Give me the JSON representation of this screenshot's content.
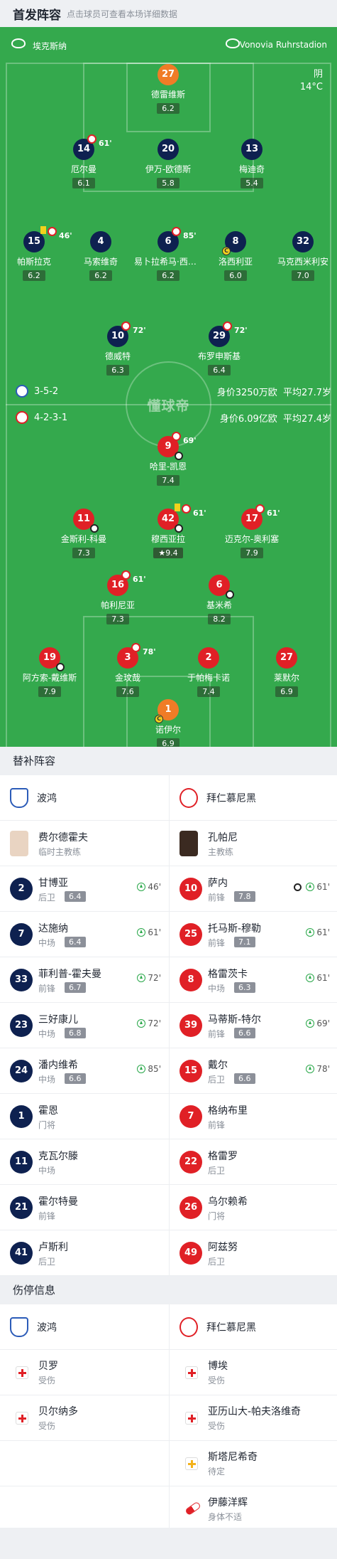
{
  "header": {
    "title": "首发阵容",
    "subtitle": "点击球员可查看本场详细数据"
  },
  "pitch": {
    "home_team": "埃克斯纳",
    "away_venue": "Vonovia Ruhrstadion",
    "weather": "阴",
    "temperature": "14°C",
    "watermark": "懂球帝",
    "home_formation": "3-5-2",
    "home_value": "身价3250万欧",
    "home_age": "平均27.7岁",
    "away_formation": "4-2-3-1",
    "away_value": "身价6.09亿欧",
    "away_age": "平均27.4岁"
  },
  "home_players": [
    {
      "num": "27",
      "name": "德雷维斯",
      "rating": "6.2"
    },
    {
      "num": "14",
      "name": "厄尔曼",
      "rating": "6.1",
      "sub": "61'"
    },
    {
      "num": "20",
      "name": "伊万-欧德斯",
      "rating": "5.8"
    },
    {
      "num": "13",
      "name": "梅迪奇",
      "rating": "5.4"
    },
    {
      "num": "15",
      "name": "帕斯拉克",
      "rating": "6.2",
      "sub": "46'"
    },
    {
      "num": "4",
      "name": "马索维奇",
      "rating": "6.2"
    },
    {
      "num": "6",
      "name": "易卜拉希马·西索科",
      "rating": "6.2",
      "sub": "85'"
    },
    {
      "num": "8",
      "name": "洛西利亚",
      "rating": "6.0"
    },
    {
      "num": "32",
      "name": "马克西米利安",
      "rating": "7.0"
    },
    {
      "num": "10",
      "name": "德威特",
      "rating": "6.3",
      "sub": "72'"
    },
    {
      "num": "29",
      "name": "布罗申斯基",
      "rating": "6.4",
      "sub": "72'"
    }
  ],
  "away_players": [
    {
      "num": "9",
      "name": "哈里-凯恩",
      "rating": "7.4",
      "sub": "69'"
    },
    {
      "num": "11",
      "name": "金斯利-科曼",
      "rating": "7.3"
    },
    {
      "num": "42",
      "name": "穆西亚拉",
      "rating": "9.4",
      "sub": "61'"
    },
    {
      "num": "17",
      "name": "迈克尔-奥利塞",
      "rating": "7.9",
      "sub": "61'"
    },
    {
      "num": "16",
      "name": "帕利尼亚",
      "rating": "7.3",
      "sub": "61'"
    },
    {
      "num": "6",
      "name": "基米希",
      "rating": "8.2"
    },
    {
      "num": "19",
      "name": "阿方索-戴维斯",
      "rating": "7.9"
    },
    {
      "num": "3",
      "name": "金玟哉",
      "rating": "7.6",
      "sub": "78'"
    },
    {
      "num": "2",
      "name": "于帕梅卡诺",
      "rating": "7.4"
    },
    {
      "num": "27",
      "name": "莱默尔",
      "rating": "6.9"
    },
    {
      "num": "1",
      "name": "诺伊尔",
      "rating": "6.9"
    }
  ],
  "subs": {
    "title": "替补阵容",
    "home_team": "波鸿",
    "away_team": "拜仁慕尼黑",
    "home_coach": {
      "name": "费尔德霍夫",
      "role": "临时主教练"
    },
    "away_coach": {
      "name": "孔帕尼",
      "role": "主教练"
    },
    "home": [
      {
        "num": "2",
        "name": "甘博亚",
        "pos": "后卫",
        "rating": "6.4",
        "min": "46'"
      },
      {
        "num": "7",
        "name": "达施纳",
        "pos": "中场",
        "rating": "6.4",
        "min": "61'"
      },
      {
        "num": "33",
        "name": "菲利普-霍夫曼",
        "pos": "前锋",
        "rating": "6.7",
        "min": "72'"
      },
      {
        "num": "23",
        "name": "三好康儿",
        "pos": "中场",
        "rating": "6.8",
        "min": "72'"
      },
      {
        "num": "24",
        "name": "潘内维希",
        "pos": "中场",
        "rating": "6.6",
        "min": "85'"
      },
      {
        "num": "1",
        "name": "霍恩",
        "pos": "门将"
      },
      {
        "num": "11",
        "name": "克瓦尔滕",
        "pos": "中场"
      },
      {
        "num": "21",
        "name": "霍尔特曼",
        "pos": "前锋"
      },
      {
        "num": "41",
        "name": "卢斯利",
        "pos": "后卫"
      }
    ],
    "away": [
      {
        "num": "10",
        "name": "萨内",
        "pos": "前锋",
        "rating": "7.8",
        "min": "61'"
      },
      {
        "num": "25",
        "name": "托马斯-穆勒",
        "pos": "前锋",
        "rating": "7.1",
        "min": "61'"
      },
      {
        "num": "8",
        "name": "格雷茨卡",
        "pos": "中场",
        "rating": "6.3",
        "min": "61'"
      },
      {
        "num": "39",
        "name": "马蒂斯-特尔",
        "pos": "前锋",
        "rating": "6.6",
        "min": "69'"
      },
      {
        "num": "15",
        "name": "戴尔",
        "pos": "后卫",
        "rating": "6.6",
        "min": "78'"
      },
      {
        "num": "7",
        "name": "格纳布里",
        "pos": "前锋"
      },
      {
        "num": "22",
        "name": "格雷罗",
        "pos": "后卫"
      },
      {
        "num": "26",
        "name": "乌尔赖希",
        "pos": "门将"
      },
      {
        "num": "49",
        "name": "阿兹努",
        "pos": "后卫"
      }
    ]
  },
  "injuries": {
    "title": "伤停信息",
    "home_team": "波鸿",
    "away_team": "拜仁慕尼黑",
    "home": [
      {
        "name": "贝罗",
        "status": "受伤"
      },
      {
        "name": "贝尔纳多",
        "status": "受伤"
      }
    ],
    "away": [
      {
        "name": "博埃",
        "status": "受伤"
      },
      {
        "name": "亚历山大-帕夫洛维奇",
        "status": "受伤"
      },
      {
        "name": "斯塔尼希奇",
        "status": "待定"
      },
      {
        "name": "伊藤洋辉",
        "status": "身体不适"
      }
    ]
  }
}
